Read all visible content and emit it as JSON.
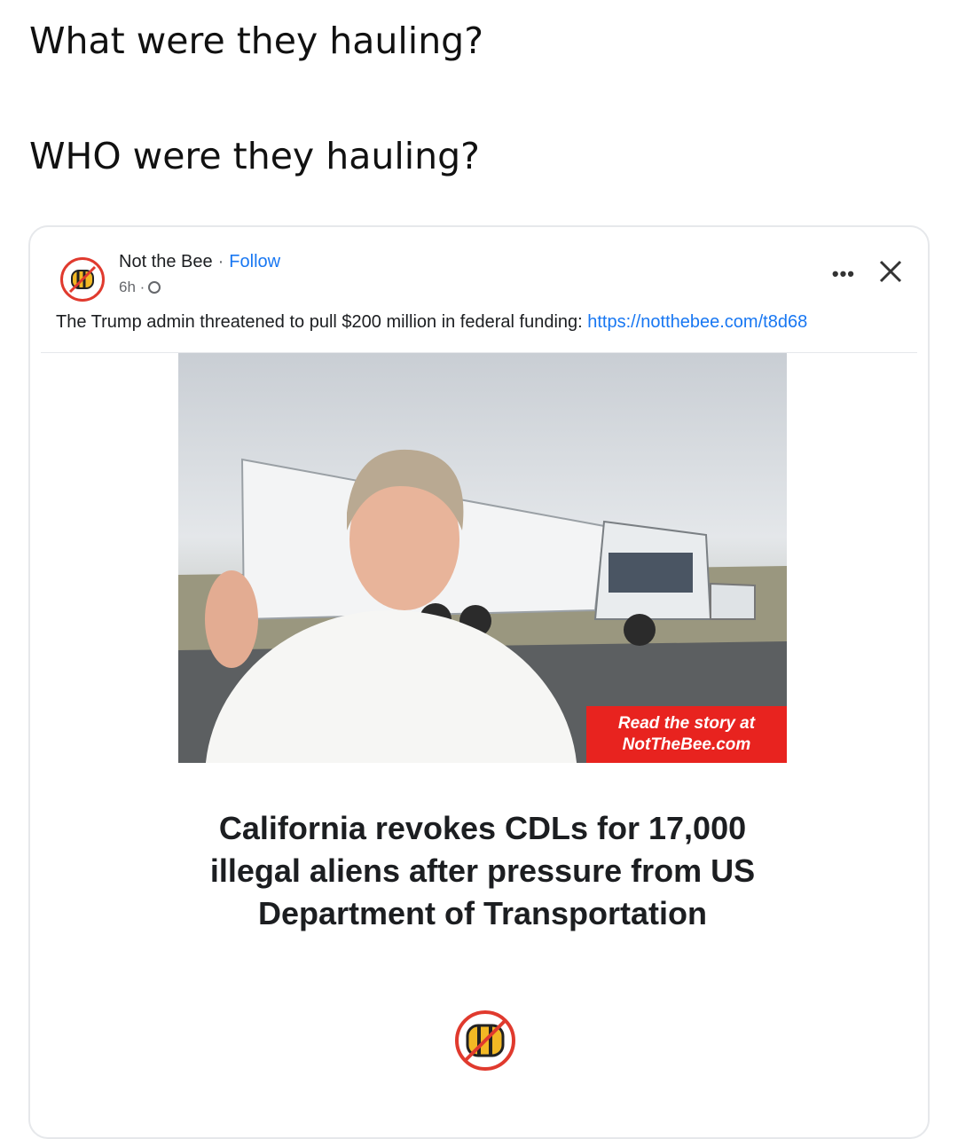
{
  "tweet": {
    "line1": "What were they hauling?",
    "line2": "WHO were they hauling?"
  },
  "post": {
    "page_name": "Not the Bee",
    "separator": "·",
    "follow_label": "Follow",
    "time": "6h ·",
    "more_label": "•••",
    "text": "The Trump admin threatened to pull $200 million in federal funding: ",
    "link": "https://notthebee.com/t8d68",
    "image": {
      "badge_line1": "Read the story at",
      "badge_line2": "NotTheBee.com"
    },
    "headline": "California revokes CDLs for 17,000 illegal aliens after pressure from US Department of Transportation"
  },
  "colors": {
    "accent_link": "#1877f2",
    "brand_red": "#e8231f",
    "bee_yellow": "#f2b824"
  },
  "icons": [
    "bee-logo-icon",
    "globe-icon",
    "more-icon",
    "close-icon"
  ]
}
